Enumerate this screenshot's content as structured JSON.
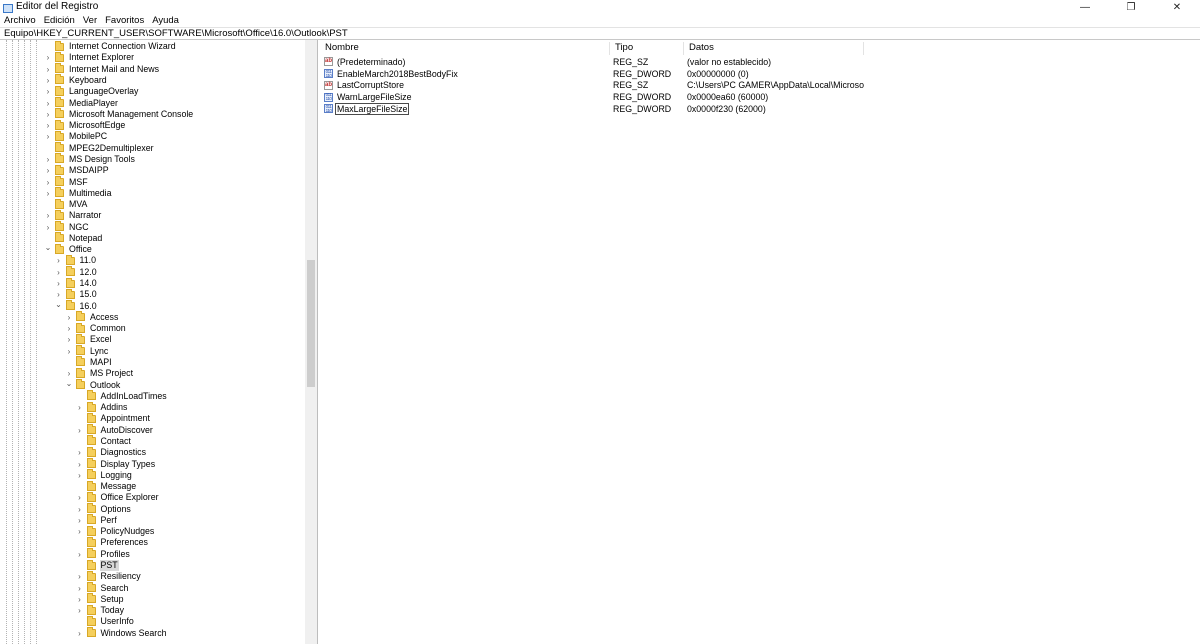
{
  "window": {
    "title": "Editor del Registro",
    "controls": [
      "—",
      "❐",
      "✕"
    ]
  },
  "menu": [
    "Archivo",
    "Edición",
    "Ver",
    "Favoritos",
    "Ayuda"
  ],
  "address": "Equipo\\HKEY_CURRENT_USER\\SOFTWARE\\Microsoft\\Office\\16.0\\Outlook\\PST",
  "tree": [
    {
      "label": "Internet Connection Wizard",
      "level": 0,
      "expander": "none"
    },
    {
      "label": "Internet Explorer",
      "level": 0,
      "expander": "collapsed"
    },
    {
      "label": "Internet Mail and News",
      "level": 0,
      "expander": "collapsed"
    },
    {
      "label": "Keyboard",
      "level": 0,
      "expander": "collapsed"
    },
    {
      "label": "LanguageOverlay",
      "level": 0,
      "expander": "collapsed"
    },
    {
      "label": "MediaPlayer",
      "level": 0,
      "expander": "collapsed"
    },
    {
      "label": "Microsoft Management Console",
      "level": 0,
      "expander": "collapsed"
    },
    {
      "label": "MicrosoftEdge",
      "level": 0,
      "expander": "collapsed"
    },
    {
      "label": "MobilePC",
      "level": 0,
      "expander": "collapsed"
    },
    {
      "label": "MPEG2Demultiplexer",
      "level": 0,
      "expander": "none"
    },
    {
      "label": "MS Design Tools",
      "level": 0,
      "expander": "collapsed"
    },
    {
      "label": "MSDAIPP",
      "level": 0,
      "expander": "collapsed"
    },
    {
      "label": "MSF",
      "level": 0,
      "expander": "collapsed"
    },
    {
      "label": "Multimedia",
      "level": 0,
      "expander": "collapsed"
    },
    {
      "label": "MVA",
      "level": 0,
      "expander": "none"
    },
    {
      "label": "Narrator",
      "level": 0,
      "expander": "collapsed"
    },
    {
      "label": "NGC",
      "level": 0,
      "expander": "collapsed"
    },
    {
      "label": "Notepad",
      "level": 0,
      "expander": "none"
    },
    {
      "label": "Office",
      "level": 0,
      "expander": "expanded"
    },
    {
      "label": "11.0",
      "level": 1,
      "expander": "collapsed"
    },
    {
      "label": "12.0",
      "level": 1,
      "expander": "collapsed"
    },
    {
      "label": "14.0",
      "level": 1,
      "expander": "collapsed"
    },
    {
      "label": "15.0",
      "level": 1,
      "expander": "collapsed"
    },
    {
      "label": "16.0",
      "level": 1,
      "expander": "expanded"
    },
    {
      "label": "Access",
      "level": 2,
      "expander": "collapsed"
    },
    {
      "label": "Common",
      "level": 2,
      "expander": "collapsed"
    },
    {
      "label": "Excel",
      "level": 2,
      "expander": "collapsed"
    },
    {
      "label": "Lync",
      "level": 2,
      "expander": "collapsed"
    },
    {
      "label": "MAPI",
      "level": 2,
      "expander": "none"
    },
    {
      "label": "MS Project",
      "level": 2,
      "expander": "collapsed"
    },
    {
      "label": "Outlook",
      "level": 2,
      "expander": "expanded"
    },
    {
      "label": "AddInLoadTimes",
      "level": 3,
      "expander": "none"
    },
    {
      "label": "Addins",
      "level": 3,
      "expander": "collapsed"
    },
    {
      "label": "Appointment",
      "level": 3,
      "expander": "none"
    },
    {
      "label": "AutoDiscover",
      "level": 3,
      "expander": "collapsed"
    },
    {
      "label": "Contact",
      "level": 3,
      "expander": "none"
    },
    {
      "label": "Diagnostics",
      "level": 3,
      "expander": "collapsed"
    },
    {
      "label": "Display Types",
      "level": 3,
      "expander": "collapsed"
    },
    {
      "label": "Logging",
      "level": 3,
      "expander": "collapsed"
    },
    {
      "label": "Message",
      "level": 3,
      "expander": "none"
    },
    {
      "label": "Office Explorer",
      "level": 3,
      "expander": "collapsed"
    },
    {
      "label": "Options",
      "level": 3,
      "expander": "collapsed"
    },
    {
      "label": "Perf",
      "level": 3,
      "expander": "collapsed"
    },
    {
      "label": "PolicyNudges",
      "level": 3,
      "expander": "collapsed"
    },
    {
      "label": "Preferences",
      "level": 3,
      "expander": "none"
    },
    {
      "label": "Profiles",
      "level": 3,
      "expander": "collapsed"
    },
    {
      "label": "PST",
      "level": 3,
      "expander": "none",
      "selected": true
    },
    {
      "label": "Resiliency",
      "level": 3,
      "expander": "collapsed"
    },
    {
      "label": "Search",
      "level": 3,
      "expander": "collapsed"
    },
    {
      "label": "Setup",
      "level": 3,
      "expander": "collapsed"
    },
    {
      "label": "Today",
      "level": 3,
      "expander": "collapsed"
    },
    {
      "label": "UserInfo",
      "level": 3,
      "expander": "none"
    },
    {
      "label": "Windows Search",
      "level": 3,
      "expander": "collapsed"
    }
  ],
  "values": {
    "headers": {
      "name": "Nombre",
      "type": "Tipo",
      "data": "Datos"
    },
    "rows": [
      {
        "name": "(Predeterminado)",
        "type": "REG_SZ",
        "data": "(valor no establecido)",
        "icon": "string-value-icon"
      },
      {
        "name": "EnableMarch2018BestBodyFix",
        "type": "REG_DWORD",
        "data": "0x00000000 (0)",
        "icon": "binary-value-icon"
      },
      {
        "name": "LastCorruptStore",
        "type": "REG_SZ",
        "data": "C:\\Users\\PC GAMER\\AppData\\Local\\Microsoft\\O...",
        "icon": "string-value-icon"
      },
      {
        "name": "WarnLargeFileSize",
        "type": "REG_DWORD",
        "data": "0x0000ea60 (60000)",
        "icon": "binary-value-icon"
      },
      {
        "name": "MaxLargeFileSize",
        "type": "REG_DWORD",
        "data": "0x0000f230 (62000)",
        "icon": "binary-value-icon",
        "focused": true
      }
    ]
  }
}
